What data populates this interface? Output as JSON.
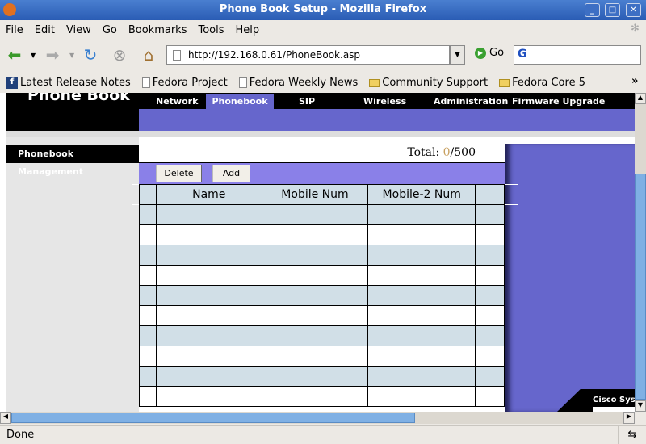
{
  "window": {
    "title": "Phone Book Setup - Mozilla Firefox"
  },
  "menu": [
    "File",
    "Edit",
    "View",
    "Go",
    "Bookmarks",
    "Tools",
    "Help"
  ],
  "nav": {
    "url": "http://192.168.0.61/PhoneBook.asp",
    "go_label": "Go"
  },
  "bookmarks": [
    "Latest Release Notes",
    "Fedora Project",
    "Fedora Weekly News",
    "Community Support",
    "Fedora Core 5"
  ],
  "page": {
    "logo_title": "Phone Book",
    "tabs": [
      "Network",
      "Phonebook",
      "SIP",
      "Wireless",
      "Administration",
      "Firmware Upgrade"
    ],
    "active_tab": "Phonebook",
    "sidebar_label": "Phonebook Management",
    "total_label": "Total: ",
    "total_count": "0",
    "total_max": "/500",
    "delete_label": "Delete",
    "add_label": "Add",
    "columns": [
      "",
      "Name",
      "Mobile Num",
      "Mobile-2 Num",
      ""
    ],
    "row_count": 10,
    "brand": "Cisco Systems",
    "colors": {
      "purple": "#6666cc",
      "toolbar": "#8a80e8",
      "row_alt": "#d1dfe7",
      "count": "#c8a060"
    }
  },
  "status": {
    "text": "Done"
  }
}
